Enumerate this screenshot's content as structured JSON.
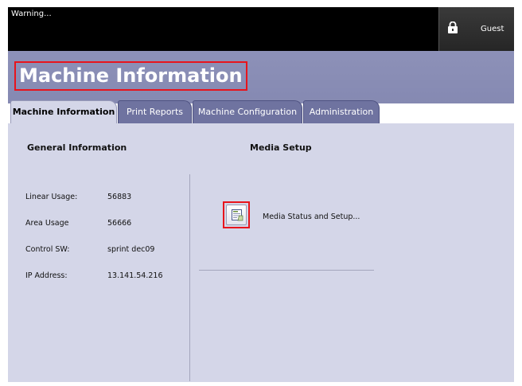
{
  "topbar": {
    "warning": "Warning...",
    "user_label": "Guest"
  },
  "header": {
    "title": "Machine Information"
  },
  "tabs": [
    {
      "label": "Machine Information",
      "active": true
    },
    {
      "label": "Print Reports",
      "active": false
    },
    {
      "label": "Machine Configuration",
      "active": false
    },
    {
      "label": "Administration",
      "active": false
    }
  ],
  "general": {
    "heading": "General Information",
    "rows": [
      {
        "label": "Linear Usage:",
        "value": "56883"
      },
      {
        "label": "Area Usage",
        "value": "56666"
      },
      {
        "label": "Control SW:",
        "value": "sprint dec09"
      },
      {
        "label": "IP Address:",
        "value": "13.141.54.216"
      }
    ]
  },
  "media": {
    "heading": "Media Setup",
    "button_label": "Media Status and Setup..."
  },
  "colors": {
    "header_bg": "#8d91b8",
    "content_bg": "#d4d6e8",
    "highlight": "#e8141c",
    "tab_bg": "#6f73a0"
  },
  "icons": {
    "user": "lock-icon",
    "media": "media-setup-icon"
  }
}
